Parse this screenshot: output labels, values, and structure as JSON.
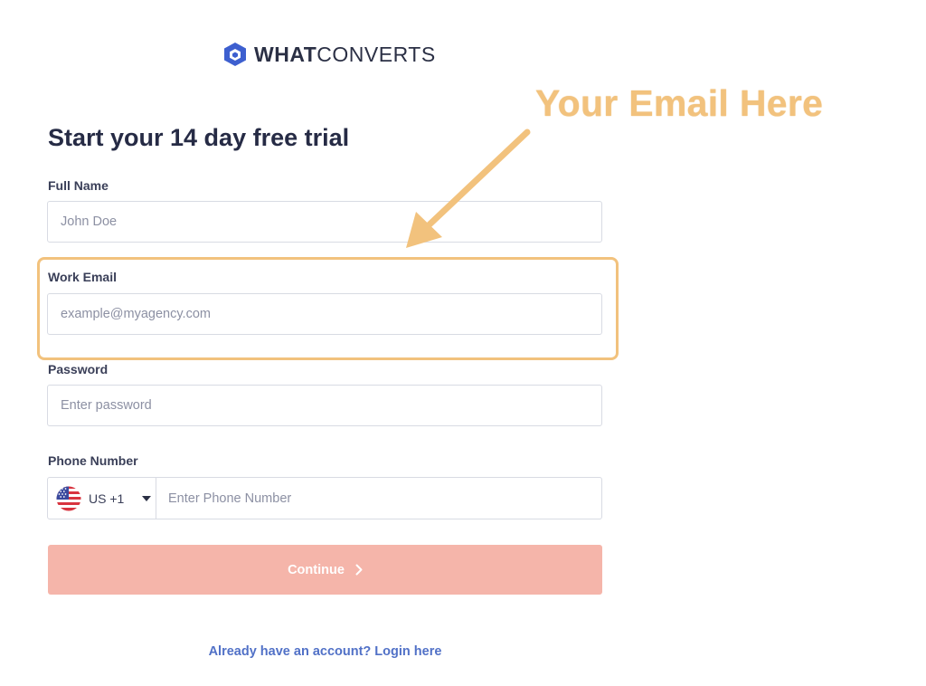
{
  "brand": {
    "name_bold": "WHAT",
    "name_light": "CONVERTS",
    "color": "#3d5fcf"
  },
  "form": {
    "title": "Start your 14 day free trial",
    "full_name": {
      "label": "Full Name",
      "placeholder": "John Doe",
      "value": ""
    },
    "work_email": {
      "label": "Work Email",
      "placeholder": "example@myagency.com",
      "value": ""
    },
    "password": {
      "label": "Password",
      "placeholder": "Enter password",
      "value": ""
    },
    "phone": {
      "label": "Phone Number",
      "country_code": "US +1",
      "flag_icon": "us-flag-icon",
      "placeholder": "Enter Phone Number",
      "value": ""
    },
    "continue_label": "Continue",
    "continue_color": "#f5b5aa",
    "login_text": "Already have an account? Login here"
  },
  "annotation": {
    "text": "Your Email Here",
    "color": "#f2c27d"
  }
}
